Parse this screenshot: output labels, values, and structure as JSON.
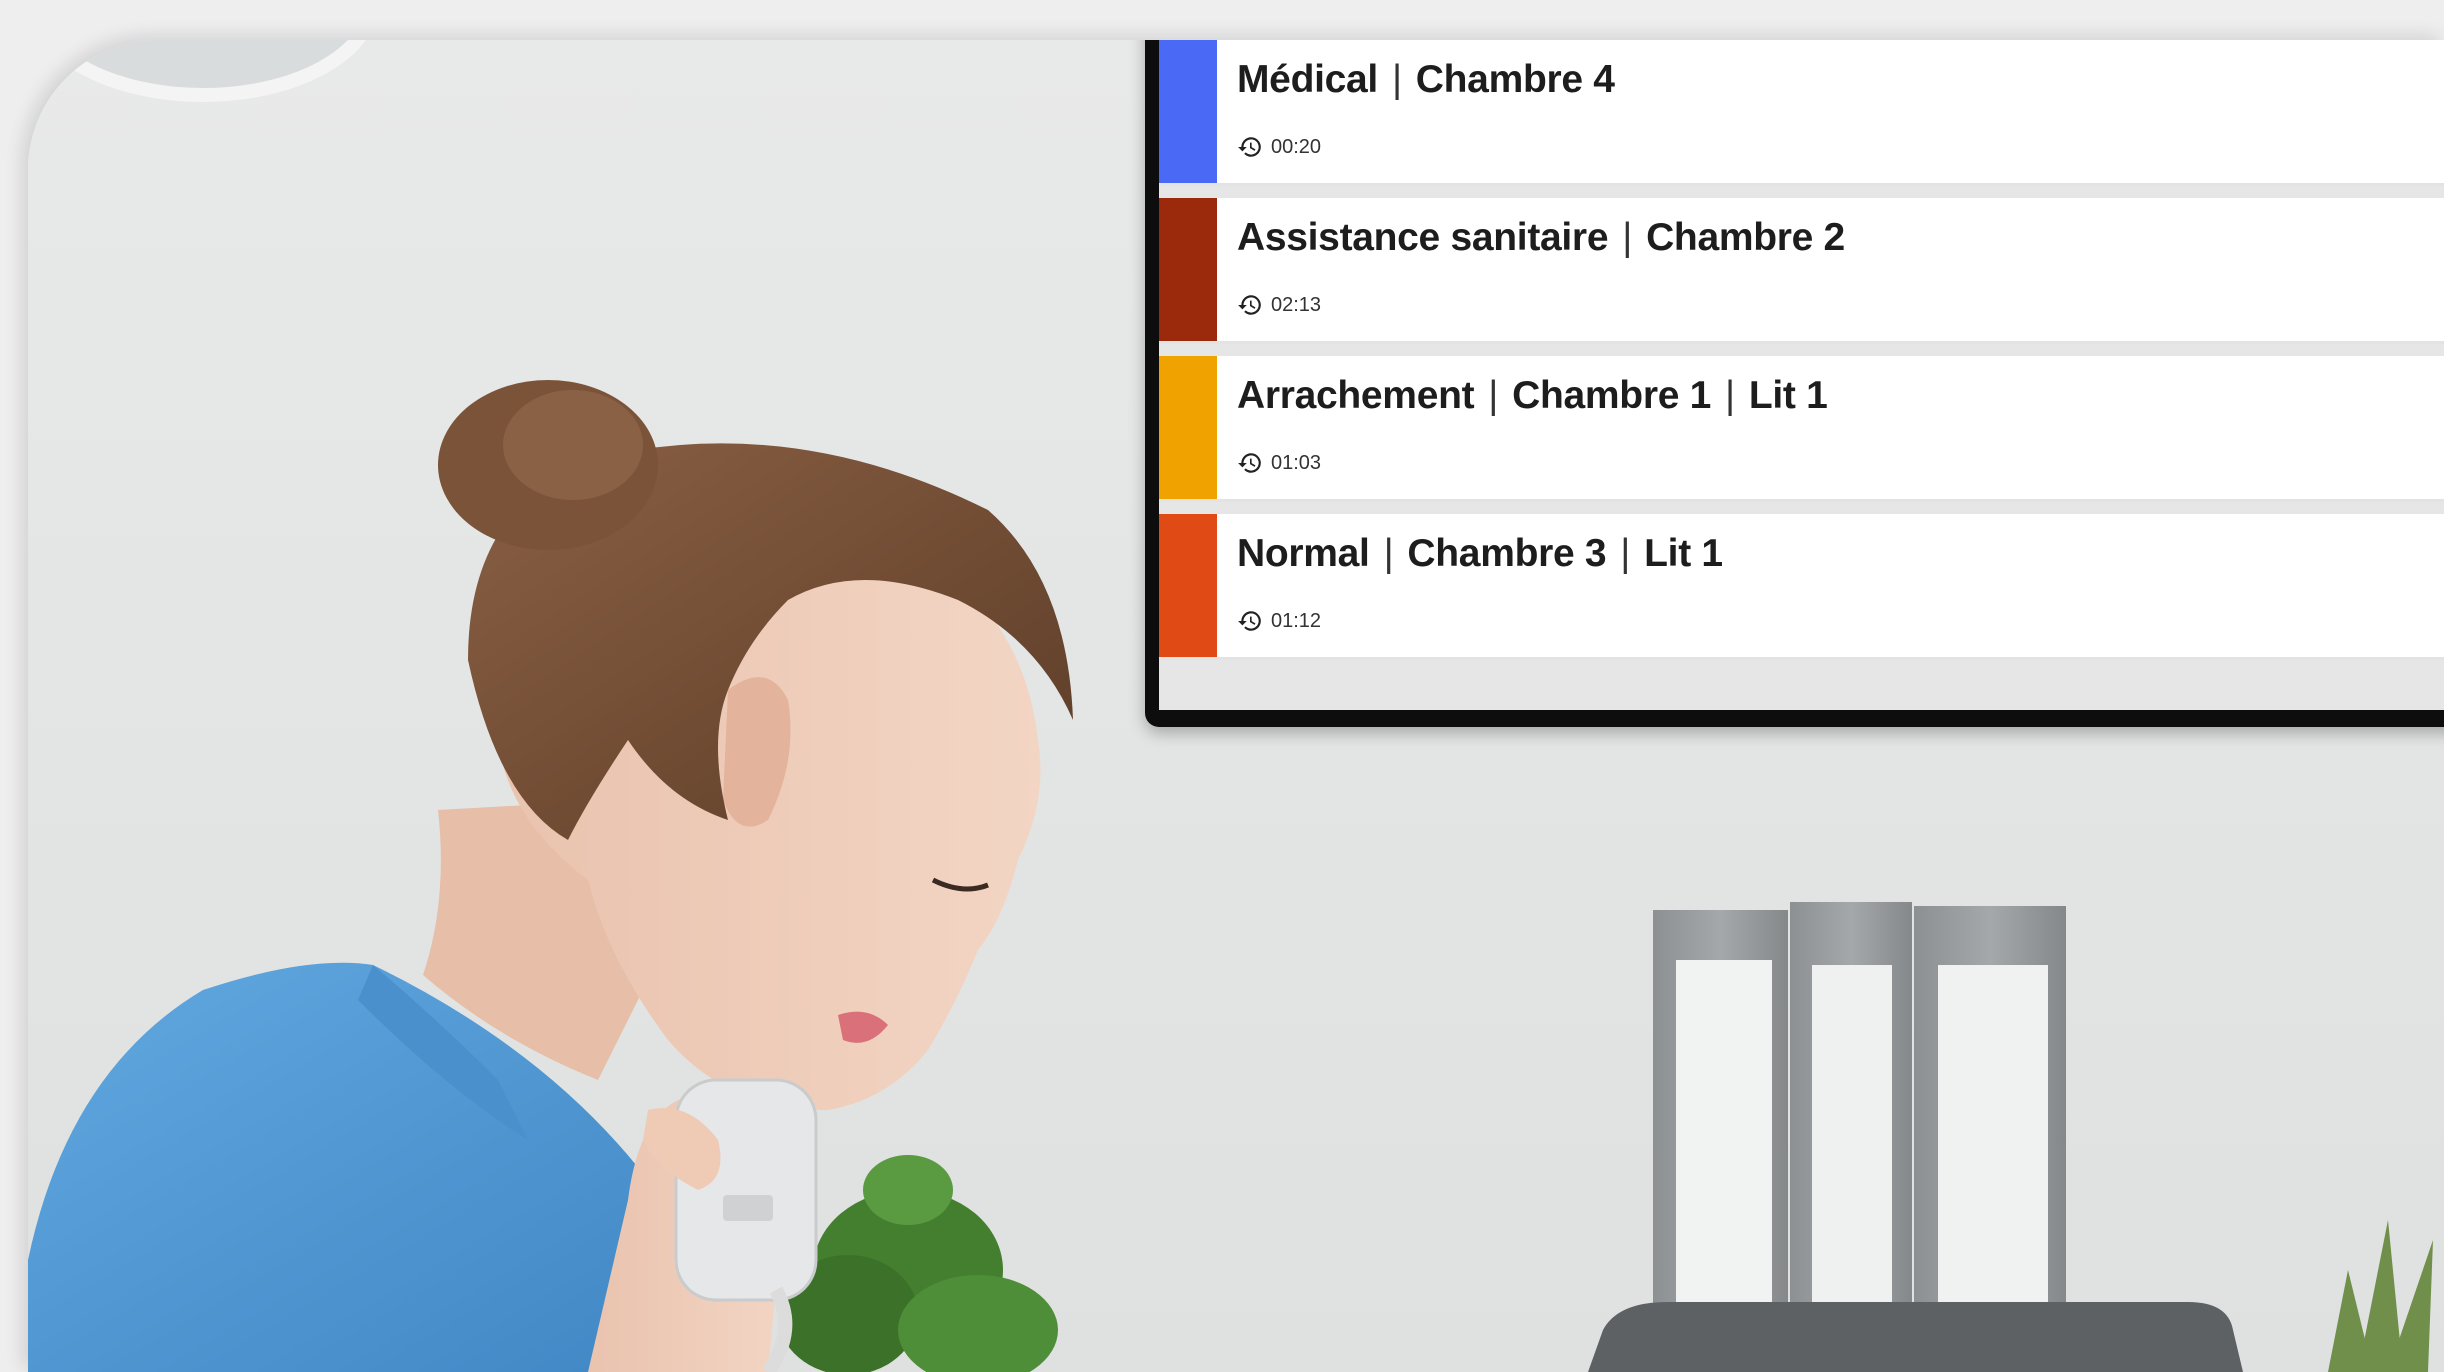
{
  "alarms": [
    {
      "type": "Médical",
      "room": "Chambre 4",
      "bed": "",
      "elapsed": "00:20",
      "color": "#4a6af6"
    },
    {
      "type": "Assistance sanitaire",
      "room": "Chambre 2",
      "bed": "",
      "elapsed": "02:13",
      "color": "#9b2a0c"
    },
    {
      "type": "Arrachement",
      "room": "Chambre 1",
      "bed": "Lit 1",
      "elapsed": "01:03",
      "color": "#f0a200"
    },
    {
      "type": "Normal",
      "room": "Chambre 3",
      "bed": "Lit 1",
      "elapsed": "01:12",
      "color": "#e04a14"
    }
  ],
  "icons": {
    "elapsed": "history-icon"
  },
  "colors": {
    "scrubs": "#5aa0d8",
    "hair": "#7a5236",
    "monitor_frame": "#0d0d0d"
  }
}
